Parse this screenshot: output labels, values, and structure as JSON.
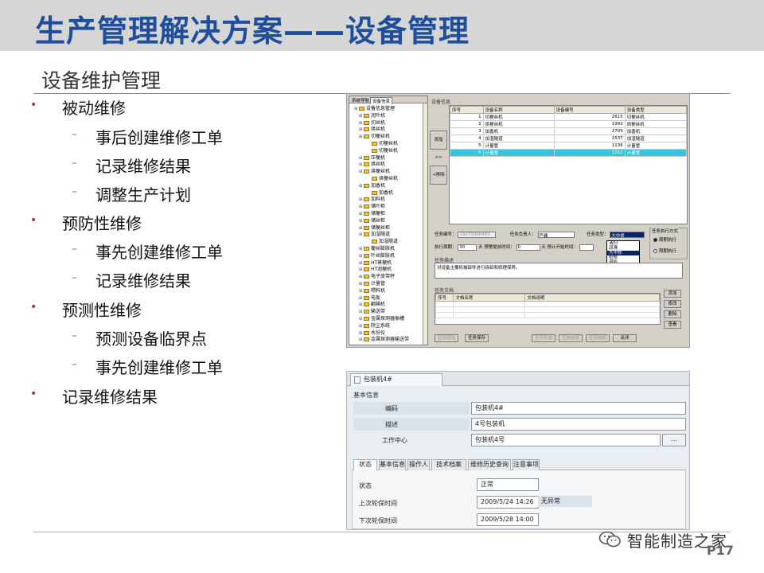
{
  "slide": {
    "title": "生产管理解决方案——设备管理",
    "subtitle": "设备维护管理",
    "page_number": "P17",
    "brand": "智能制造之家"
  },
  "bullets": [
    {
      "level": 1,
      "text": "被动维修"
    },
    {
      "level": 2,
      "text": "事后创建维修工单"
    },
    {
      "level": 2,
      "text": "记录维修结果"
    },
    {
      "level": 2,
      "text": "调整生产计划"
    },
    {
      "level": 1,
      "text": "预防性维修"
    },
    {
      "level": 2,
      "text": "事先创建维修工单"
    },
    {
      "level": 2,
      "text": "记录维修结果"
    },
    {
      "level": 1,
      "text": "预测性维修"
    },
    {
      "level": 2,
      "text": "预测设备临界点"
    },
    {
      "level": 2,
      "text": "事先创建维修工单"
    },
    {
      "level": 1,
      "text": "记录维修结果"
    }
  ],
  "app1": {
    "tabs": [
      "系统导航",
      "设备信息"
    ],
    "tree": [
      {
        "level": 0,
        "text": "设备信息管理"
      },
      {
        "level": 1,
        "text": "润叶机"
      },
      {
        "level": 1,
        "text": "切丝机"
      },
      {
        "level": 1,
        "text": "烘丝机"
      },
      {
        "level": 1,
        "text": "切梗丝机"
      },
      {
        "level": 2,
        "text": "切梗丝机"
      },
      {
        "level": 2,
        "text": "切梗丝机"
      },
      {
        "level": 1,
        "text": "压梗机"
      },
      {
        "level": 1,
        "text": "烘丝机"
      },
      {
        "level": 1,
        "text": "烘梗丝机"
      },
      {
        "level": 2,
        "text": "烘梗丝机"
      },
      {
        "level": 1,
        "text": "加香机"
      },
      {
        "level": 2,
        "text": "加香机"
      },
      {
        "level": 1,
        "text": "加料机"
      },
      {
        "level": 1,
        "text": "储叶柜"
      },
      {
        "level": 1,
        "text": "储梗柜"
      },
      {
        "level": 1,
        "text": "储丝柜"
      },
      {
        "level": 1,
        "text": "储梗丝柜"
      },
      {
        "level": 1,
        "text": "加湿隧道"
      },
      {
        "level": 2,
        "text": "加湿隧道"
      },
      {
        "level": 1,
        "text": "梗丝膨胀机"
      },
      {
        "level": 1,
        "text": "叶丝膨胀机"
      },
      {
        "level": 1,
        "text": "HT蒸梗机"
      },
      {
        "level": 1,
        "text": "HT润梗机"
      },
      {
        "level": 1,
        "text": "电子皮带秤"
      },
      {
        "level": 1,
        "text": "计量管"
      },
      {
        "level": 1,
        "text": "喂料机"
      },
      {
        "level": 1,
        "text": "电扳"
      },
      {
        "level": 1,
        "text": "翻箱机"
      },
      {
        "level": 1,
        "text": "输送带"
      },
      {
        "level": 1,
        "text": "金属探测器振槽"
      },
      {
        "level": 1,
        "text": "除尘系统"
      },
      {
        "level": 1,
        "text": "水份仪"
      },
      {
        "level": 1,
        "text": "金属探测器输送带"
      }
    ],
    "group_device_info": "设备信息",
    "grid_headers": [
      "序号",
      "设备名称",
      "设备编号",
      "设备类型"
    ],
    "grid_rows": [
      {
        "no": "1",
        "name": "切梗丝机",
        "code": "2615",
        "type": "切梗丝机",
        "selected": false
      },
      {
        "no": "2",
        "name": "烘梗丝机",
        "code": "1992",
        "type": "烘梗丝机",
        "selected": false
      },
      {
        "no": "3",
        "name": "加香机",
        "code": "2705",
        "type": "加香机",
        "selected": false
      },
      {
        "no": "4",
        "name": "加湿隧道",
        "code": "1537",
        "type": "加湿隧道",
        "selected": false
      },
      {
        "no": "5",
        "name": "计量管",
        "code": "1136",
        "type": "计量管",
        "selected": false
      },
      {
        "no": "6",
        "name": "计量管",
        "code": "1262",
        "type": "计量管",
        "selected": true
      }
    ],
    "add_button": "添加>>",
    "remove_button": "<移除",
    "task_no_label": "任务编号：",
    "task_no_value": "19070060483",
    "owner_label": "任务负责人：",
    "owner_value": "严峰",
    "type_label": "任务类型：",
    "type_value": "大中修",
    "dropdown_options": [
      "清扫",
      "润滑",
      "大中修",
      "检修",
      "巡检"
    ],
    "dropdown_selected": 2,
    "exec_group": "任务执行方式",
    "exec_options": [
      "周期执行",
      "限期执行"
    ],
    "period_label": "执行周期：",
    "period_value": "30",
    "advance_label": "天 预警提前时间：",
    "advance_value": "0",
    "start_label": "天 预计开始时间：",
    "desc_group": "任务描述",
    "desc_value": "对设备主要机械部件进行拆卸和修理保养。",
    "doc_group": "任务文档",
    "doc_headers": [
      "序号",
      "文档名称",
      "文档说明"
    ],
    "doc_buttons": [
      "添加",
      "修改",
      "删除",
      "查看"
    ],
    "bottom_buttons": [
      {
        "label": "任务修改",
        "disabled": true
      },
      {
        "label": "任务保存",
        "disabled": false
      },
      {
        "label": "任务开始",
        "disabled": true
      },
      {
        "label": "任务结束",
        "disabled": true
      },
      {
        "label": "任务撤销",
        "disabled": true
      },
      {
        "label": "关闭",
        "disabled": false
      }
    ]
  },
  "app2": {
    "tab_title": "包装机4#",
    "section_title": "基本信息",
    "code_label": "编码",
    "code_value": "包装机4#",
    "desc_label": "描述",
    "desc_value": "4号包装机",
    "center_label": "工作中心",
    "center_value": "包装机4号",
    "browse_label": "...",
    "tabs": [
      "状态",
      "基本信息",
      "操作人",
      "技术档案",
      "维修历史查询",
      "注意事项"
    ],
    "active_tab": 0,
    "status_label": "状态",
    "status_value": "正常",
    "last_label": "上次轮保时间",
    "last_value": "2009/5/24 14:26",
    "last_extra": "无异常",
    "next_label": "下次轮保时间",
    "next_value": "2009/5/28 14:00"
  }
}
